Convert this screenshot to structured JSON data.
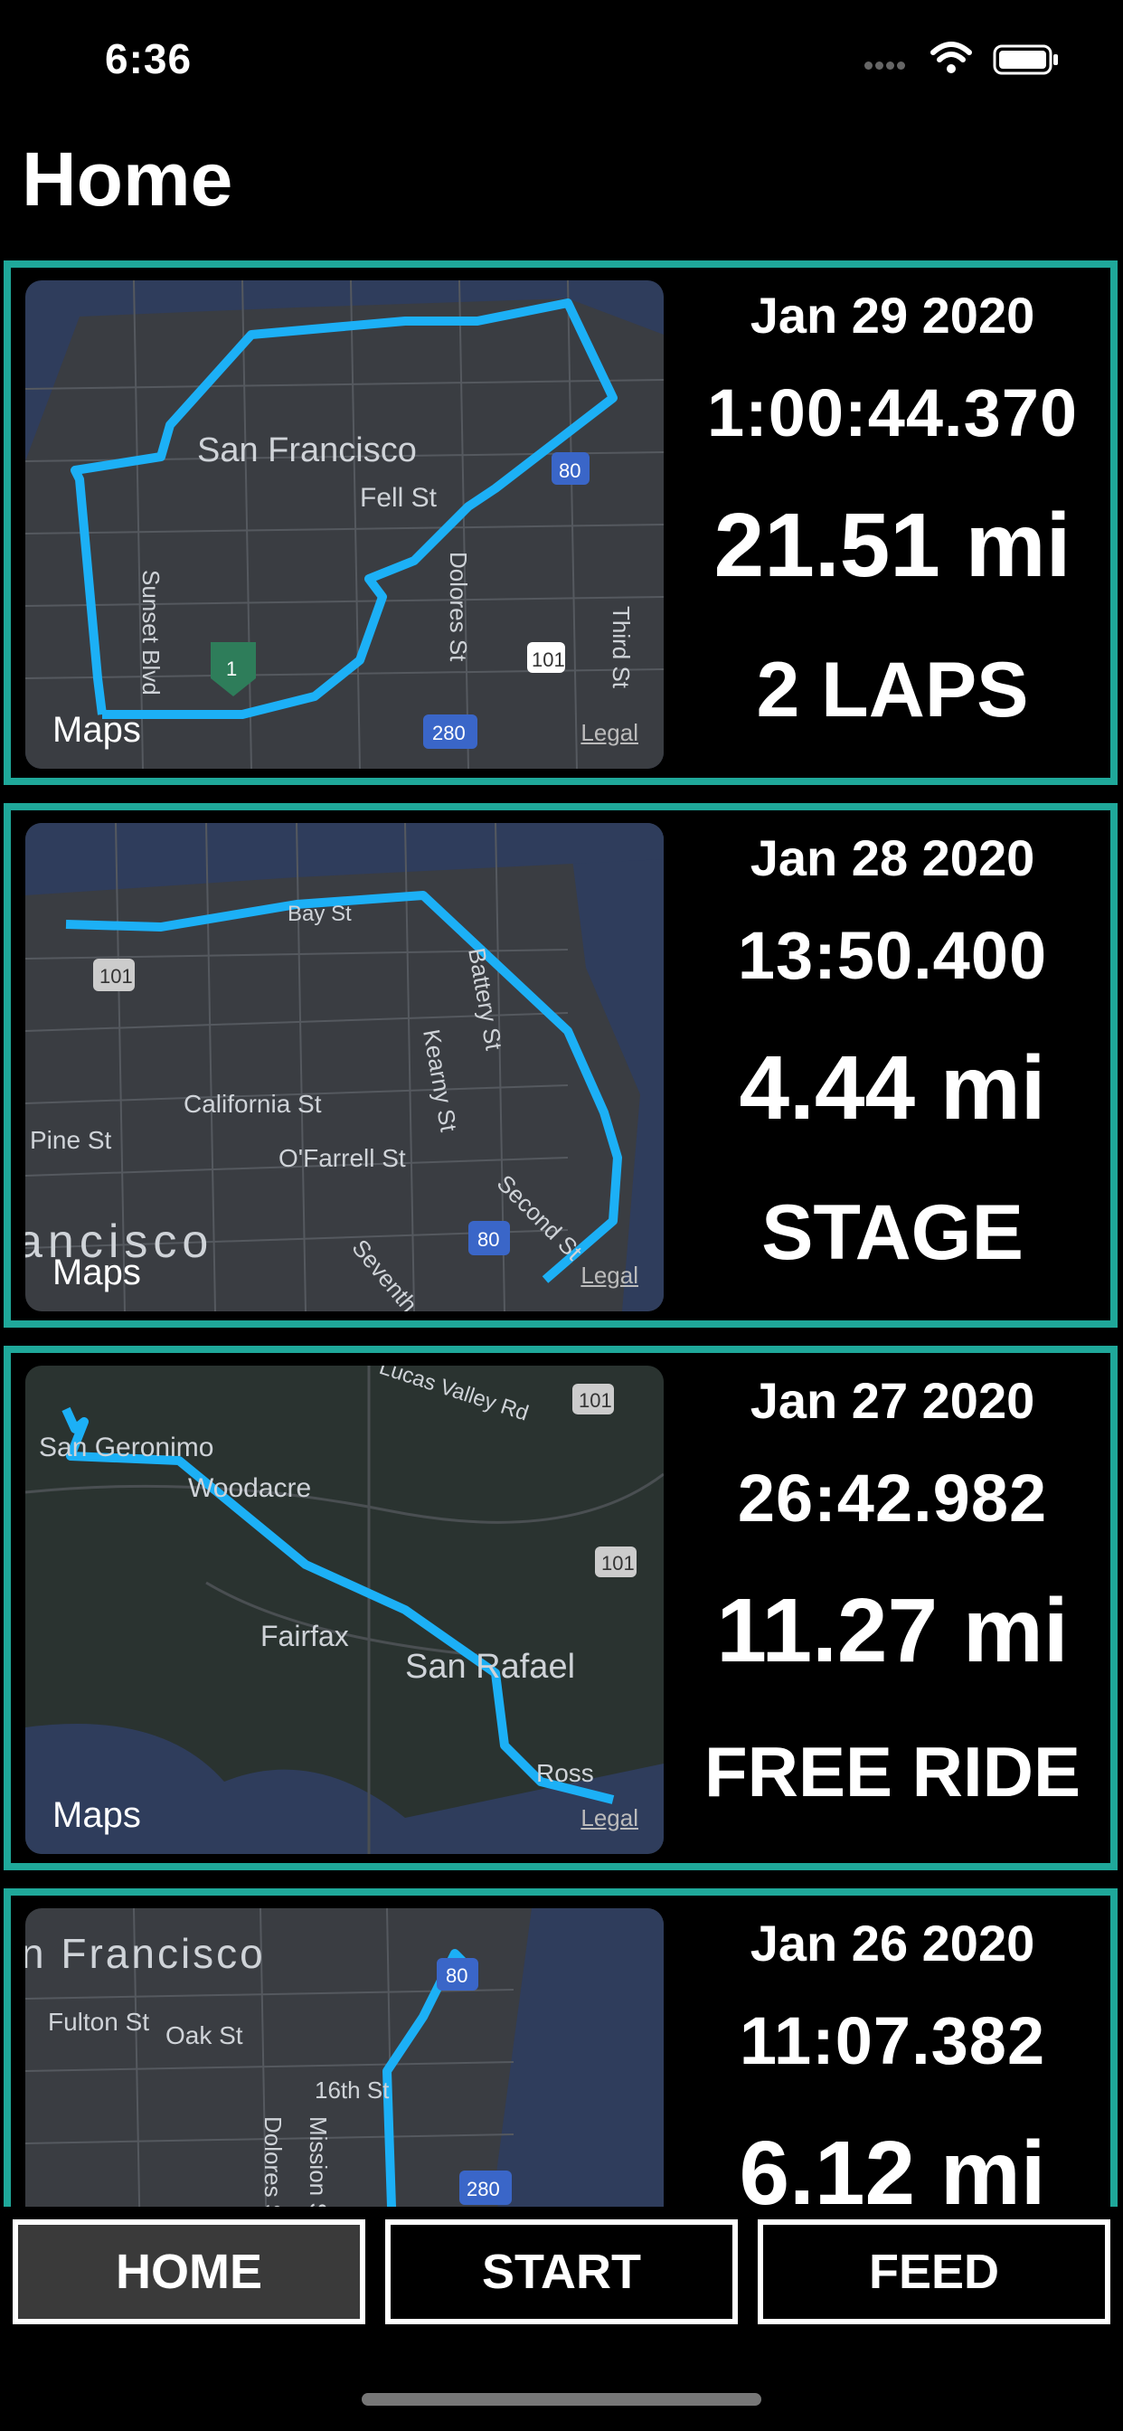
{
  "status": {
    "time": "6:36"
  },
  "header": {
    "title": "Home"
  },
  "rides": [
    {
      "date": "Jan 29 2020",
      "duration": "1:00:44.370",
      "distance": "21.51 mi",
      "type": "2 LAPS",
      "map": {
        "labels": [
          "San Francisco",
          "Fell St",
          "Sunset Blvd",
          "Dolores St",
          "Third St",
          "101",
          "80",
          "280",
          "1"
        ]
      }
    },
    {
      "date": "Jan 28 2020",
      "duration": "13:50.400",
      "distance": "4.44 mi",
      "type": "STAGE",
      "map": {
        "labels": [
          "Bay St",
          "Battery St",
          "Kearny St",
          "California St",
          "Pine St",
          "O'Farrell St",
          "Second St",
          "ancisco",
          "Seventh",
          "101",
          "80"
        ]
      }
    },
    {
      "date": "Jan 27 2020",
      "duration": "26:42.982",
      "distance": "11.27 mi",
      "type": "FREE RIDE",
      "map": {
        "labels": [
          "San Geronimo",
          "Woodacre",
          "Fairfax",
          "San Rafael",
          "Ross",
          "Lucas Valley Rd",
          "101"
        ]
      }
    },
    {
      "date": "Jan 26 2020",
      "duration": "11:07.382",
      "distance": "6.12 mi",
      "type": "",
      "map": {
        "labels": [
          "n Francisco",
          "Fulton St",
          "Oak St",
          "16th St",
          "Dolores St",
          "Mission St",
          "80",
          "280"
        ]
      }
    }
  ],
  "map_attribution": {
    "logo": "Maps",
    "legal": "Legal"
  },
  "tabs": [
    {
      "label": "HOME",
      "active": true
    },
    {
      "label": "START",
      "active": false
    },
    {
      "label": "FEED",
      "active": false
    }
  ],
  "colors": {
    "route": "#1cb0f6",
    "card_border": "#1fa89a",
    "map_bg": "#2f3d5c"
  }
}
